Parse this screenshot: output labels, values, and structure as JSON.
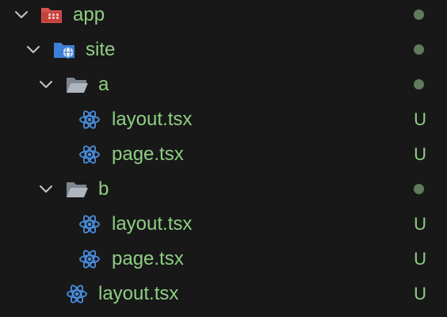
{
  "colors": {
    "background": "#181818",
    "untracked_text": "#8fce84",
    "status_dot": "#607a5c",
    "react_icon": "#4a90e2",
    "folder_gray": "#9aa3ad",
    "app_folder_red": "#d9534f",
    "site_folder_blue": "#3f7fd6"
  },
  "tree": [
    {
      "label": "app",
      "status": "",
      "icon": "folder-app-icon",
      "expanded": true
    },
    {
      "label": "site",
      "status": "",
      "icon": "folder-site-icon",
      "expanded": true
    },
    {
      "label": "a",
      "status": "",
      "icon": "folder-open-icon",
      "expanded": true
    },
    {
      "label": "layout.tsx",
      "status": "U",
      "icon": "react-icon"
    },
    {
      "label": "page.tsx",
      "status": "U",
      "icon": "react-icon"
    },
    {
      "label": "b",
      "status": "",
      "icon": "folder-open-icon",
      "expanded": true
    },
    {
      "label": "layout.tsx",
      "status": "U",
      "icon": "react-icon"
    },
    {
      "label": "page.tsx",
      "status": "U",
      "icon": "react-icon"
    },
    {
      "label": "layout.tsx",
      "status": "U",
      "icon": "react-icon"
    }
  ]
}
